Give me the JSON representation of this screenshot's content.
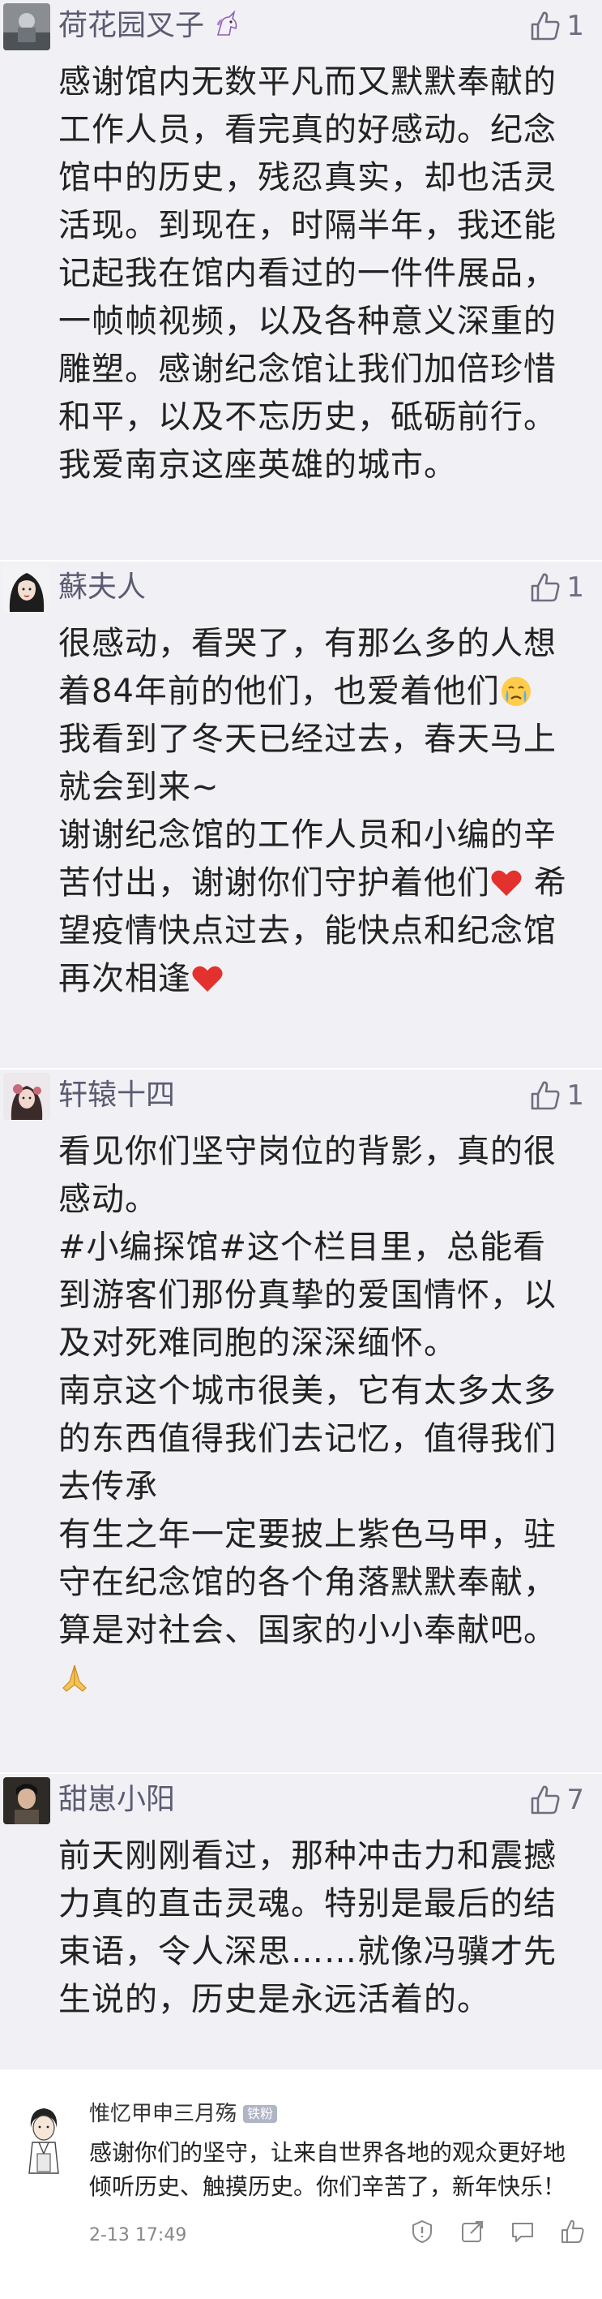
{
  "comments": [
    {
      "username": "荷花园叉子",
      "likes": "1",
      "paragraphs": [
        "感谢馆内无数平凡而又默默奉献的工作人员，看完真的好感动。纪念馆中的历史，残忍真实，却也活灵活现。到现在，时隔半年，我还能记起我在馆内看过的一件件展品，一帧帧视频，以及各种意义深重的雕塑。感谢纪念馆让我们加倍珍惜和平，以及不忘历史，砥砺前行。我爱南京这座英雄的城市。"
      ]
    },
    {
      "username": "蘇夫人",
      "likes": "1",
      "p1": "很感动，看哭了，有那么多的人想着84年前的他们，也爱着他们",
      "p2": "我看到了冬天已经过去，春天马上就会到来~",
      "p3a": "谢谢纪念馆的工作人员和小编的辛苦付出，谢谢你们守护着他们",
      "p3b": " 希望疫情快点过去，能快点和纪念馆再次相逢"
    },
    {
      "username": "轩辕十四",
      "likes": "1",
      "p1": "看见你们坚守岗位的背影，真的很感动。",
      "p2": "#小编探馆#这个栏目里，总能看到游客们那份真挚的爱国情怀，以及对死难同胞的深深缅怀。",
      "p3": "南京这个城市很美，它有太多太多的东西值得我们去记忆，值得我们去传承",
      "p4": "有生之年一定要披上紫色马甲，驻守在纪念馆的各个角落默默奉献，算是对社会、国家的小小奉献吧。"
    },
    {
      "username": "甜崽小阳",
      "likes": "7",
      "p1": "前天刚刚看过，那种冲击力和震撼力真的直击灵魂。特别是最后的结束语，令人深思……就像冯骥才先生说的，历史是永远活着的。"
    }
  ],
  "bottom_comment": {
    "username": "惟忆甲申三月殇",
    "tag": "铁粉",
    "text": "感谢你们的坚守，让来自世界各地的观众更好地倾听历史、触摸历史。你们辛苦了，新年快乐！",
    "date": "2-13 17:49"
  },
  "colors": {
    "card_bg": "#f1f1f5",
    "username": "#5b5b73",
    "icon": "#6e6e80",
    "heart": "#e3312d"
  },
  "icons": [
    "thumbs-up-icon",
    "heart-icon",
    "crying-face-icon",
    "praying-hands-icon",
    "unicorn-icon",
    "report-icon",
    "share-icon",
    "comment-icon",
    "like-icon"
  ]
}
